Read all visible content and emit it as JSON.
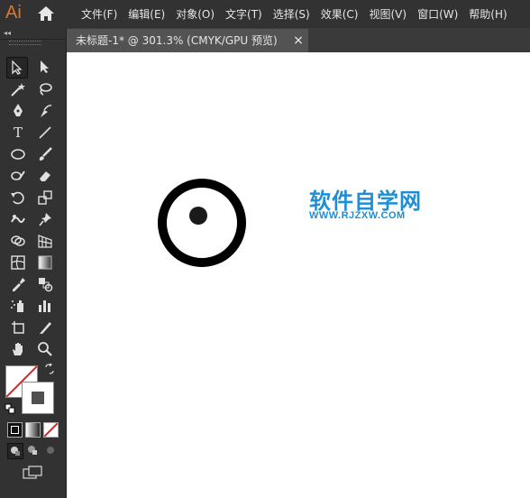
{
  "app": {
    "logo": "Ai"
  },
  "menu": [
    "文件(F)",
    "编辑(E)",
    "对象(O)",
    "文字(T)",
    "选择(S)",
    "效果(C)",
    "视图(V)",
    "窗口(W)",
    "帮助(H)"
  ],
  "toolbar": {
    "collapse": "◂◂"
  },
  "tab": {
    "title": "未标题-1* @ 301.3% (CMYK/GPU 预览)",
    "close": "×"
  },
  "watermark": {
    "title": "软件自学网",
    "url": "WWW.RJZXW.COM"
  },
  "colors": {
    "accent": "#1c8fd6",
    "logo": "#e0772a",
    "panel": "#323232",
    "workspace": "#535353"
  }
}
